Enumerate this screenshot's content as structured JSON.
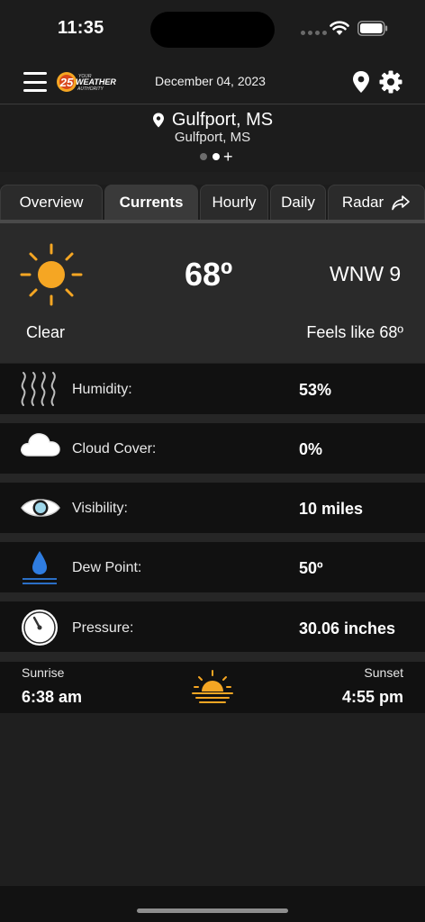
{
  "status_bar": {
    "time": "11:35"
  },
  "header": {
    "logo_number": "25",
    "logo_text_top": "YOUR",
    "logo_text_mid": "WEATHER",
    "logo_text_bottom": "AUTHORITY",
    "date": "December 04, 2023",
    "icons": [
      "menu-icon",
      "location-pin-icon",
      "gear-icon"
    ]
  },
  "location": {
    "name": "Gulfport, MS",
    "subtitle": "Gulfport, MS",
    "add_symbol": "+"
  },
  "tabs": [
    {
      "label": "Overview"
    },
    {
      "label": "Currents"
    },
    {
      "label": "Hourly"
    },
    {
      "label": "Daily"
    },
    {
      "label": "Radar"
    }
  ],
  "active_tab": "Currents",
  "current": {
    "temperature": "68º",
    "wind": "WNW 9",
    "condition": "Clear",
    "feels_like": "Feels like 68º",
    "icon": "sun-icon"
  },
  "details": [
    {
      "label": "Humidity:",
      "value": "53%",
      "icon": "humidity-icon"
    },
    {
      "label": "Cloud Cover:",
      "value": "0%",
      "icon": "cloud-icon"
    },
    {
      "label": "Visibility:",
      "value": "10 miles",
      "icon": "eye-icon"
    },
    {
      "label": "Dew Point:",
      "value": "50º",
      "icon": "water-drop-icon"
    },
    {
      "label": "Pressure:",
      "value": "30.06 inches",
      "icon": "gauge-icon"
    }
  ],
  "sun": {
    "sunrise_label": "Sunrise",
    "sunrise_time": "6:38 am",
    "sunset_label": "Sunset",
    "sunset_time": "4:55 pm"
  },
  "colors": {
    "accent_orange": "#f5a623",
    "drop_blue": "#2f7de1",
    "background": "#1f1f1f"
  }
}
